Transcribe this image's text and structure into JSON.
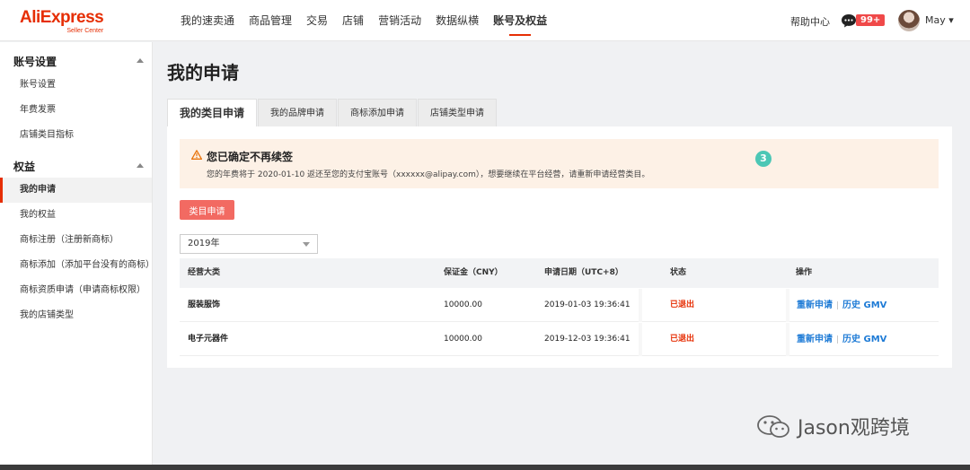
{
  "header": {
    "brand": "AliExpress",
    "brand_sub": "Seller Center",
    "nav": [
      "我的速卖通",
      "商品管理",
      "交易",
      "店铺",
      "营销活动",
      "数据纵横",
      "账号及权益"
    ],
    "active_nav": "账号及权益",
    "help": "帮助中心",
    "badge": "99+",
    "user": "May ▾"
  },
  "sidebar": {
    "groups": [
      {
        "title": "账号设置",
        "items": [
          "账号设置",
          "年费发票",
          "店铺类目指标"
        ]
      },
      {
        "title": "权益",
        "items": [
          "我的申请",
          "我的权益",
          "商标注册（注册新商标）",
          "商标添加（添加平台没有的商标）",
          "商标资质申请（申请商标权限）",
          "我的店铺类型"
        ]
      }
    ],
    "active_item": "我的申请"
  },
  "main": {
    "title": "我的申请",
    "tabs": [
      "我的类目申请",
      "我的品牌申请",
      "商标添加申请",
      "店铺类型申请"
    ],
    "active_tab": "我的类目申请",
    "notice": {
      "title": "您已确定不再续签",
      "text": "您的年费将于 2020-01-10 返还至您的支付宝账号（xxxxxx@alipay.com），想要继续在平台经营，请重新申请经营类目。",
      "step_marker": "3"
    },
    "apply_button": "类目申请",
    "year_select": {
      "value": "2019年"
    },
    "table": {
      "headers": [
        "经营大类",
        "保证金（CNY）",
        "申请日期（UTC+8）",
        "状态",
        "操作"
      ],
      "rows": [
        {
          "category": "服装服饰",
          "deposit": "10000.00",
          "date": "2019-01-03 19:36:41",
          "status": "已退出",
          "action1": "重新申请",
          "action2": "历史 GMV"
        },
        {
          "category": "电子元器件",
          "deposit": "10000.00",
          "date": "2019-12-03 19:36:41",
          "status": "已退出",
          "action1": "重新申请",
          "action2": "历史 GMV"
        }
      ]
    }
  },
  "watermark": "Jason观跨境",
  "colors": {
    "brand": "#e62e04",
    "link": "#1e7bd6",
    "warn_bg": "#fdf1e6",
    "button": "#f26a62"
  }
}
